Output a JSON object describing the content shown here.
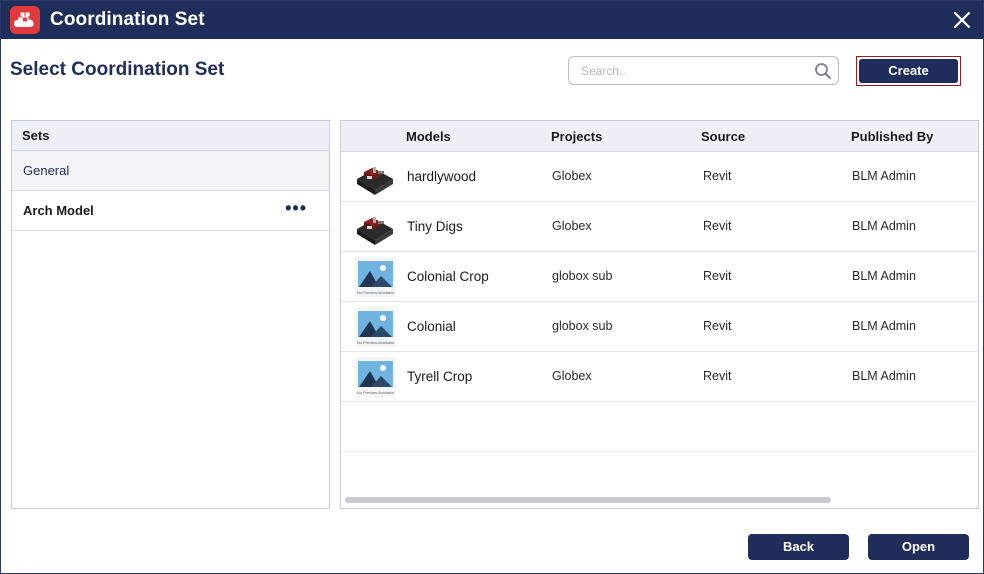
{
  "window": {
    "title": "Coordination Set",
    "app_icon": "cloud-blocks-logo",
    "close_icon": "close-icon"
  },
  "page": {
    "title": "Select Coordination Set"
  },
  "search": {
    "placeholder": "Search..",
    "value": "",
    "icon": "search-icon"
  },
  "toolbar": {
    "create_label": "Create"
  },
  "sets": {
    "header": "Sets",
    "items": [
      {
        "label": "General",
        "selected": true
      },
      {
        "label": "Arch Model",
        "selected": false,
        "more_label": "•••"
      }
    ]
  },
  "models": {
    "columns": [
      "Models",
      "Projects",
      "Source",
      "Published By"
    ],
    "rows": [
      {
        "name": "hardlywood",
        "project": "Globex",
        "source": "Revit",
        "published_by": "BLM Admin",
        "thumb": "model-thumbnail"
      },
      {
        "name": "Tiny Digs",
        "project": "Globex",
        "source": "Revit",
        "published_by": "BLM Admin",
        "thumb": "model-thumbnail"
      },
      {
        "name": "Colonial Crop",
        "project": "globox sub",
        "source": "Revit",
        "published_by": "BLM Admin",
        "thumb": "no-preview-thumbnail"
      },
      {
        "name": "Colonial",
        "project": "globox sub",
        "source": "Revit",
        "published_by": "BLM Admin",
        "thumb": "no-preview-thumbnail"
      },
      {
        "name": "Tyrell Crop",
        "project": "Globex",
        "source": "Revit",
        "published_by": "BLM Admin",
        "thumb": "no-preview-thumbnail"
      }
    ],
    "no_preview_text": "No Preview Available"
  },
  "footer": {
    "back_label": "Back",
    "open_label": "Open"
  },
  "colors": {
    "primary": "#1f2d5a",
    "logo": "#e03a3e",
    "create_outline": "#9b1c1c"
  }
}
